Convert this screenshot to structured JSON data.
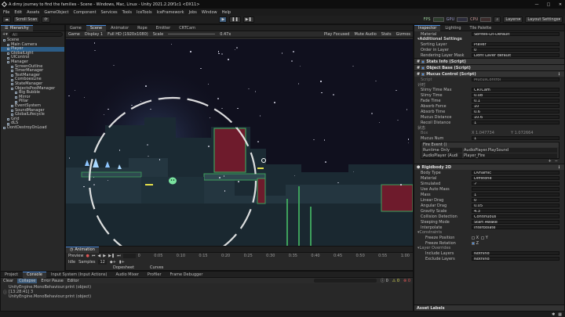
{
  "window": {
    "title": "A dimy journey to find the families - Scene - Windows, Mac, Linux - Unity 2021.2.20f1c1 <DX11>"
  },
  "menu": [
    "File",
    "Edit",
    "Assets",
    "GameObject",
    "Component",
    "Services",
    "Tools",
    "IceTools",
    "IceFramework",
    "Jobs",
    "Window",
    "Help"
  ],
  "toolbar": {
    "account": "Scroll Scan",
    "fps": "FPS",
    "gpu": "GPU",
    "cpu": "CPU",
    "layers": "Layers",
    "layout": "Layout Settings"
  },
  "hierarchy": {
    "tab": "Hierarchy",
    "search_placeholder": "All",
    "items": [
      {
        "label": "Scene",
        "depth": 0
      },
      {
        "label": "Main Camera",
        "depth": 1
      },
      {
        "label": "Player",
        "depth": 1
      },
      {
        "label": "GlobalLight",
        "depth": 1
      },
      {
        "label": "UIControl",
        "depth": 1
      },
      {
        "label": "Manager",
        "depth": 1
      },
      {
        "label": "ScreenOutline",
        "depth": 2
      },
      {
        "label": "TimerManager",
        "depth": 2
      },
      {
        "label": "TextManager",
        "depth": 2
      },
      {
        "label": "ComboesLine",
        "depth": 2
      },
      {
        "label": "StateManager",
        "depth": 2
      },
      {
        "label": "ObjectsPoolManager",
        "depth": 2
      },
      {
        "label": "Big Bubble",
        "depth": 3
      },
      {
        "label": "Mirror",
        "depth": 3
      },
      {
        "label": "Pillar",
        "depth": 3
      },
      {
        "label": "EventSystem",
        "depth": 2
      },
      {
        "label": "SoundManager",
        "depth": 2
      },
      {
        "label": "GlobalLifecycle",
        "depth": 2
      },
      {
        "label": "Grid",
        "depth": 1
      },
      {
        "label": "dLS",
        "depth": 1
      },
      {
        "label": "DontDestroyOnLoad",
        "depth": 0
      }
    ]
  },
  "scene": {
    "tabs": [
      "Game",
      "Scene",
      "Animator",
      "Rope",
      "Emitter",
      "CRTCam"
    ],
    "active_tab": "Scene",
    "toolbar": {
      "display": "Game",
      "display_no": "Display 1",
      "resolution": "Full HD (1920x1080)",
      "scale_label": "Scale",
      "scale_value": "0.47x",
      "play_mode": "Play Focused",
      "mute": "Mute Audio",
      "stats": "Stats",
      "gizmos": "Gizmos"
    }
  },
  "animation": {
    "tab": "Animation",
    "preview": "Preview",
    "clip": "Idle",
    "samples_label": "Samples",
    "samples_value": "12",
    "time_marks": [
      "0",
      "0:05",
      "0:10",
      "0:15",
      "0:20",
      "0:25",
      "0:30",
      "0:35",
      "0:40",
      "0:45",
      "0:50",
      "0:55",
      "1:00"
    ],
    "footer": [
      "Dopesheet",
      "Curves"
    ]
  },
  "console": {
    "tabs": [
      "Project",
      "Console",
      "Input System (Input Actions)",
      "Audio Mixer",
      "Profiler",
      "Frame Debugger"
    ],
    "active_tab": "Console",
    "toolbar": [
      "Clear",
      "Collapse",
      "Error Pause",
      "Editor"
    ],
    "logs": [
      "UnityEngine.MonoBehaviour:print (object)",
      "[13:28:41] 3",
      "UnityEngine.MonoBehaviour:print (object)"
    ],
    "counts": [
      "0",
      "0",
      "0"
    ]
  },
  "inspector": {
    "tabs": [
      "Inspector",
      "Lighting",
      "Tile Palette"
    ],
    "material_label": "Material",
    "material_value": "Sprites-Lit-Default",
    "additional_settings": "Additional Settings",
    "sorting_layer_label": "Sorting Layer",
    "sorting_layer_value": "Player",
    "order_label": "Order in Layer",
    "order_value": "0",
    "rendering_mask_label": "Rendering Layer Mask",
    "rendering_mask_value": "Light Layer default",
    "components": [
      "Stats Info (Script)",
      "Object Base (Script)",
      "Mucus Control (Script)"
    ],
    "script_label": "Script",
    "script_value": "MucusControl",
    "section_timing": "计时",
    "fields": [
      {
        "label": "Slimy Time Max",
        "value": "CRTCam"
      },
      {
        "label": "Slimy Time",
        "value": "0.08"
      },
      {
        "label": "Fade Time",
        "value": "0.1"
      },
      {
        "label": "Absorb Force",
        "value": "10"
      },
      {
        "label": "Absorb Time",
        "value": "0.6"
      },
      {
        "label": "Mucus Distance",
        "value": "10.6"
      },
      {
        "label": "Recoil Distance",
        "value": "1"
      }
    ],
    "section_state": "状态",
    "box_label": "Box",
    "box_x": "X 1.047734",
    "box_y": "Y 1.072664",
    "mucus_num_label": "Mucus Num",
    "mucus_num_value": "1",
    "event_label": "Fire Event ()",
    "event_mode": "Runtime Only",
    "event_func": "AudioPlayer.PlaySound",
    "event_target": "AudioPlayer (Audi",
    "event_arg": "Player_Fire",
    "rigidbody": {
      "title": "Rigidbody 2D",
      "rows": [
        {
          "label": "Body Type",
          "value": "Dynamic"
        },
        {
          "label": "Material",
          "value": "Diffstone"
        },
        {
          "label": "Simulated",
          "value": "✓"
        },
        {
          "label": "Use Auto Mass",
          "value": ""
        },
        {
          "label": "Mass",
          "value": "1"
        },
        {
          "label": "Linear Drag",
          "value": "0"
        },
        {
          "label": "Angular Drag",
          "value": "0.05"
        },
        {
          "label": "Gravity Scale",
          "value": "4.3"
        },
        {
          "label": "Collision Detection",
          "value": "Continuous"
        },
        {
          "label": "Sleeping Mode",
          "value": "Start Awake"
        },
        {
          "label": "Interpolate",
          "value": "Interpolate"
        }
      ],
      "constraints": "Constraints",
      "freeze_position": "Freeze Position",
      "freeze_rotation": "Freeze Rotation",
      "layer_overrides": "Layer Overrides",
      "include_layers": "Include Layers",
      "include_value": "Nothing",
      "exclude_layers": "Exclude Layers",
      "exclude_value": "Nothing"
    },
    "asset_labels": "Asset Labels"
  },
  "colors": {
    "accent": "#4a8adb",
    "scene_bg": "#0f0f1c",
    "tile_wall": "#4a6e74",
    "tile_edge": "#3ea05c",
    "hazard": "#6e1b2c",
    "slime": "#7be3a0"
  }
}
